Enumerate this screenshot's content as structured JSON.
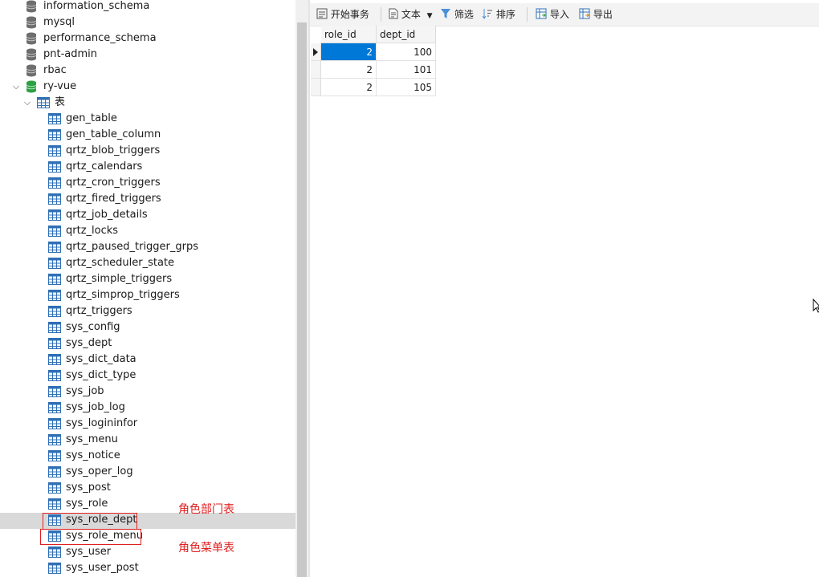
{
  "sidebar": {
    "databases": [
      {
        "label": "information_schema"
      },
      {
        "label": "mysql"
      },
      {
        "label": "performance_schema"
      },
      {
        "label": "pnt-admin"
      },
      {
        "label": "rbac"
      },
      {
        "label": "ry-vue"
      }
    ],
    "tables_folder": {
      "label": "表"
    },
    "tables": [
      {
        "label": "gen_table"
      },
      {
        "label": "gen_table_column"
      },
      {
        "label": "qrtz_blob_triggers"
      },
      {
        "label": "qrtz_calendars"
      },
      {
        "label": "qrtz_cron_triggers"
      },
      {
        "label": "qrtz_fired_triggers"
      },
      {
        "label": "qrtz_job_details"
      },
      {
        "label": "qrtz_locks"
      },
      {
        "label": "qrtz_paused_trigger_grps"
      },
      {
        "label": "qrtz_scheduler_state"
      },
      {
        "label": "qrtz_simple_triggers"
      },
      {
        "label": "qrtz_simprop_triggers"
      },
      {
        "label": "qrtz_triggers"
      },
      {
        "label": "sys_config"
      },
      {
        "label": "sys_dept"
      },
      {
        "label": "sys_dict_data"
      },
      {
        "label": "sys_dict_type"
      },
      {
        "label": "sys_job"
      },
      {
        "label": "sys_job_log"
      },
      {
        "label": "sys_logininfor"
      },
      {
        "label": "sys_menu"
      },
      {
        "label": "sys_notice"
      },
      {
        "label": "sys_oper_log"
      },
      {
        "label": "sys_post"
      },
      {
        "label": "sys_role"
      },
      {
        "label": "sys_role_dept"
      },
      {
        "label": "sys_role_menu"
      },
      {
        "label": "sys_user"
      },
      {
        "label": "sys_user_post"
      }
    ],
    "selected_table": "sys_role_dept"
  },
  "annotations": {
    "role_dept": "角色部门表",
    "role_menu": "角色菜单表"
  },
  "toolbar": {
    "begin_transaction": "开始事务",
    "text": "文本",
    "filter": "筛选",
    "sort": "排序",
    "import": "导入",
    "export": "导出"
  },
  "grid": {
    "columns": [
      "role_id",
      "dept_id"
    ],
    "rows": [
      {
        "role_id": "2",
        "dept_id": "100"
      },
      {
        "role_id": "2",
        "dept_id": "101"
      },
      {
        "role_id": "2",
        "dept_id": "105"
      }
    ]
  },
  "colors": {
    "annotation": "#e02020",
    "selection": "#0078d7",
    "db_icon": "#6e6e6e",
    "db_icon_active": "#2ea043",
    "table_icon": "#2f6fb4"
  }
}
